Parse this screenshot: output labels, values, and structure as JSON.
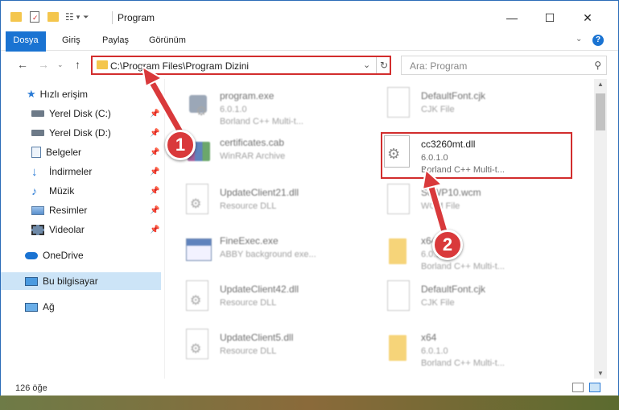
{
  "window": {
    "title": "Program",
    "minimize": "—",
    "maximize": "☐",
    "close": "✕"
  },
  "ribbon": {
    "tabs": [
      "Dosya",
      "Giriş",
      "Paylaş",
      "Görünüm"
    ]
  },
  "address": {
    "path": "C:\\Program Files\\Program Dizini",
    "search_placeholder": "Ara: Program"
  },
  "sidebar": {
    "items": [
      {
        "label": "Hızlı erişim",
        "icon": "star-icon"
      },
      {
        "label": "Yerel Disk (C:)",
        "icon": "drive-icon",
        "pinned": true
      },
      {
        "label": "Yerel Disk (D:)",
        "icon": "drive-icon",
        "pinned": true
      },
      {
        "label": "Belgeler",
        "icon": "documents-icon",
        "pinned": true
      },
      {
        "label": "İndirmeler",
        "icon": "download-icon",
        "pinned": true
      },
      {
        "label": "Müzik",
        "icon": "music-icon",
        "pinned": true
      },
      {
        "label": "Resimler",
        "icon": "pictures-icon",
        "pinned": true
      },
      {
        "label": "Videolar",
        "icon": "videos-icon",
        "pinned": true
      },
      {
        "label": "OneDrive",
        "icon": "cloud-icon"
      },
      {
        "label": "Bu bilgisayar",
        "icon": "computer-icon",
        "selected": true
      },
      {
        "label": "Ağ",
        "icon": "network-icon"
      }
    ]
  },
  "files": {
    "left": [
      {
        "name": "program.exe",
        "line1": "6.0.1.0",
        "line2": "Borland C++ Multi-t..."
      },
      {
        "name": "certificates.cab",
        "line1": "WinRAR Archive",
        "line2": ""
      },
      {
        "name": "UpdateClient21.dll",
        "line1": "Resource DLL",
        "line2": ""
      },
      {
        "name": "FineExec.exe",
        "line1": "ABBY background exe...",
        "line2": ""
      },
      {
        "name": "UpdateClient42.dll",
        "line1": "Resource DLL",
        "line2": ""
      },
      {
        "name": "UpdateClient5.dll",
        "line1": "Resource DLL",
        "line2": ""
      }
    ],
    "right": [
      {
        "name": "DefaultFont.cjk",
        "line1": "CJK File",
        "line2": ""
      },
      {
        "name": "cc3260mt.dll",
        "line1": "6.0.1.0",
        "line2": "Borland C++ Multi-t..."
      },
      {
        "name": "ScWP10.wcm",
        "line1": "WCM File",
        "line2": ""
      },
      {
        "name": "x64",
        "line1": "6.0.1.0",
        "line2": "Borland C++ Multi-t..."
      },
      {
        "name": "DefaultFont.cjk",
        "line1": "CJK File",
        "line2": ""
      },
      {
        "name": "x64",
        "line1": "6.0.1.0",
        "line2": "Borland C++ Multi-t..."
      }
    ]
  },
  "status": {
    "count": "126 öğe"
  },
  "annotations": {
    "badge1": "1",
    "badge2": "2"
  },
  "colors": {
    "accent": "#1a73d2",
    "highlight": "#d22d2d",
    "badge": "#d9393b",
    "selected": "#cce4f7"
  }
}
